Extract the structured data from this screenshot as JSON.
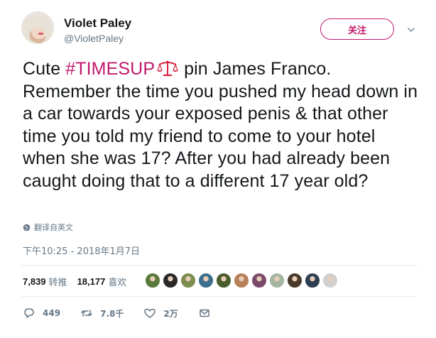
{
  "user": {
    "name": "Violet Paley",
    "handle": "@VioletPaley"
  },
  "follow_button": {
    "label": "关注"
  },
  "tweet": {
    "before_hashtag": "Cute ",
    "hashtag": "#TIMESUP",
    "hashtag_emoji": "scales-emoji",
    "after_hashtag": " pin James Franco. Remember the time you pushed my head down in a car towards your exposed penis & that other time you told my friend to come to your hotel when she was 17? After you had already been caught doing that to a different 17 year old?"
  },
  "translate": {
    "label": "翻译自英文",
    "icon": "globe-icon"
  },
  "timestamp": "下午10:25 - 2018年1月7日",
  "stats": {
    "retweets": {
      "count": "7,839",
      "label": "转推"
    },
    "likes": {
      "count": "18,177",
      "label": "喜欢"
    }
  },
  "likers": [
    {
      "color": "#5a7a3a"
    },
    {
      "color": "#2a2a2a"
    },
    {
      "color": "#7d8c4f"
    },
    {
      "color": "#3f6f8f"
    },
    {
      "color": "#4a5d2c"
    },
    {
      "color": "#b8805a"
    },
    {
      "color": "#7a4a6a"
    },
    {
      "color": "#a4b5a0"
    },
    {
      "color": "#4a3a2a"
    },
    {
      "color": "#2c3e50"
    },
    {
      "color": "#d0d0d0"
    }
  ],
  "actions": {
    "reply": {
      "count": "449",
      "icon": "reply-icon"
    },
    "retweet": {
      "count": "7.8千",
      "icon": "retweet-icon"
    },
    "like": {
      "count": "2万",
      "icon": "heart-icon"
    },
    "dm": {
      "icon": "envelope-icon"
    }
  },
  "colors": {
    "accent": "#c0196b",
    "text": "#14171a",
    "secondary": "#657786",
    "divider": "#e6ecf0"
  }
}
